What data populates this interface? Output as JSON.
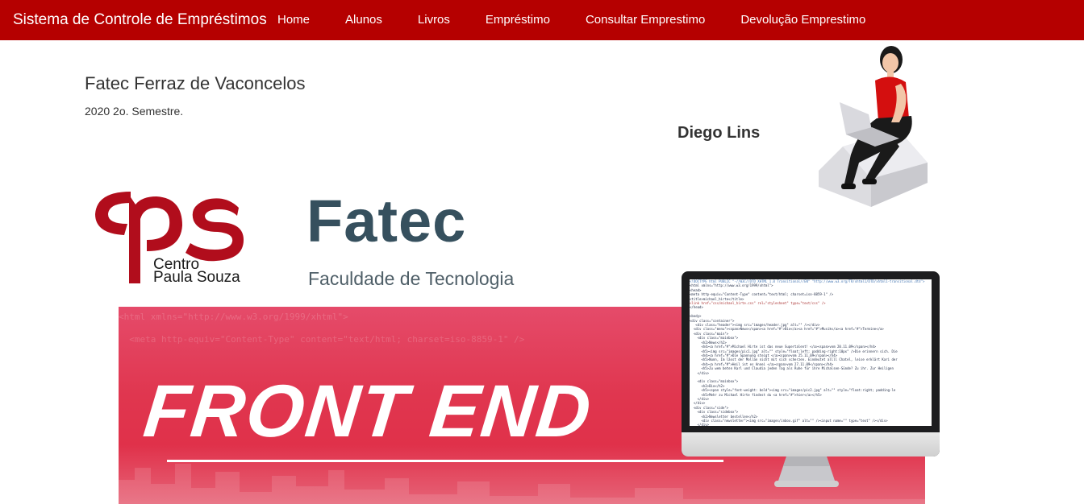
{
  "navbar": {
    "brand": "Sistema de Controle de Empréstimos",
    "links": [
      "Home",
      "Alunos",
      "Livros",
      "Empréstimo",
      "Consultar Emprestimo",
      "Devolução Emprestimo"
    ]
  },
  "header": {
    "school": "Fatec Ferraz de Vaconcelos",
    "semester": "2020 2o. Semestre.",
    "author": "Diego Lins"
  },
  "logos": {
    "cps": {
      "line1": "Centro",
      "line2": "Paula Souza"
    },
    "fatec": {
      "name": "Fatec",
      "subtitle": "Faculdade de Tecnologia"
    }
  },
  "banner": {
    "title": "FRONT END"
  },
  "colors": {
    "brand": "#b50000",
    "banner": "#e0364f",
    "fatec": "#36505e"
  },
  "icons": [
    "woman-laptop-illustration",
    "monitor-illustration",
    "cps-logo"
  ]
}
